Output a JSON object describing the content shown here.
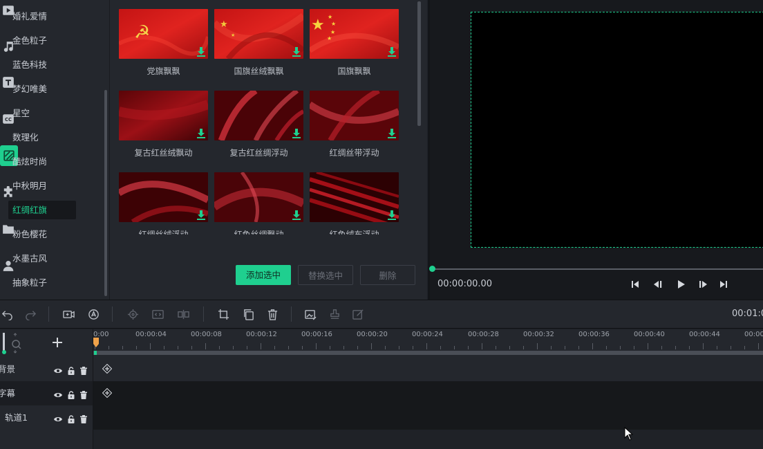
{
  "rail": {
    "icons": [
      "video-icon",
      "music-icon",
      "text-icon",
      "caption-icon",
      "background-icon",
      "plugin-icon",
      "folder-icon",
      "person-icon"
    ]
  },
  "categories": [
    "婚礼爱情",
    "金色粒子",
    "蓝色科技",
    "梦幻唯美",
    "星空",
    "数理化",
    "酷炫时尚",
    "中秋明月",
    "红绸红旗",
    "粉色樱花",
    "水墨古风",
    "抽象粒子"
  ],
  "active_category": "红绸红旗",
  "grid": {
    "items": [
      {
        "label": "党旗飘飘"
      },
      {
        "label": "国旗丝绒飘飘"
      },
      {
        "label": "国旗飘飘"
      },
      {
        "label": "复古红丝绒飘动"
      },
      {
        "label": "复古红丝绸浮动"
      },
      {
        "label": "红绸丝带浮动"
      },
      {
        "label": "红绸丝绒浮动"
      },
      {
        "label": "红色丝绸飘动"
      },
      {
        "label": "红色绒布浮动"
      }
    ],
    "add_selected_label": "添加选中",
    "replace_selected_label": "替换选中",
    "delete_label": "删除"
  },
  "preview": {
    "timecode": "00:00:00.00",
    "total_time": "00:01:0"
  },
  "ruler": {
    "labels": [
      "0:00",
      "00:00:04",
      "00:00:08",
      "00:00:12",
      "00:00:16",
      "00:00:20",
      "00:00:24",
      "00:00:28",
      "00:00:32",
      "00:00:36",
      "00:00:40",
      "00:00:44",
      "00:00:"
    ]
  },
  "tracks": [
    {
      "name": "背景"
    },
    {
      "name": "字幕"
    },
    {
      "name": "轨道1"
    }
  ],
  "colors": {
    "accent": "#1fcf8f"
  }
}
